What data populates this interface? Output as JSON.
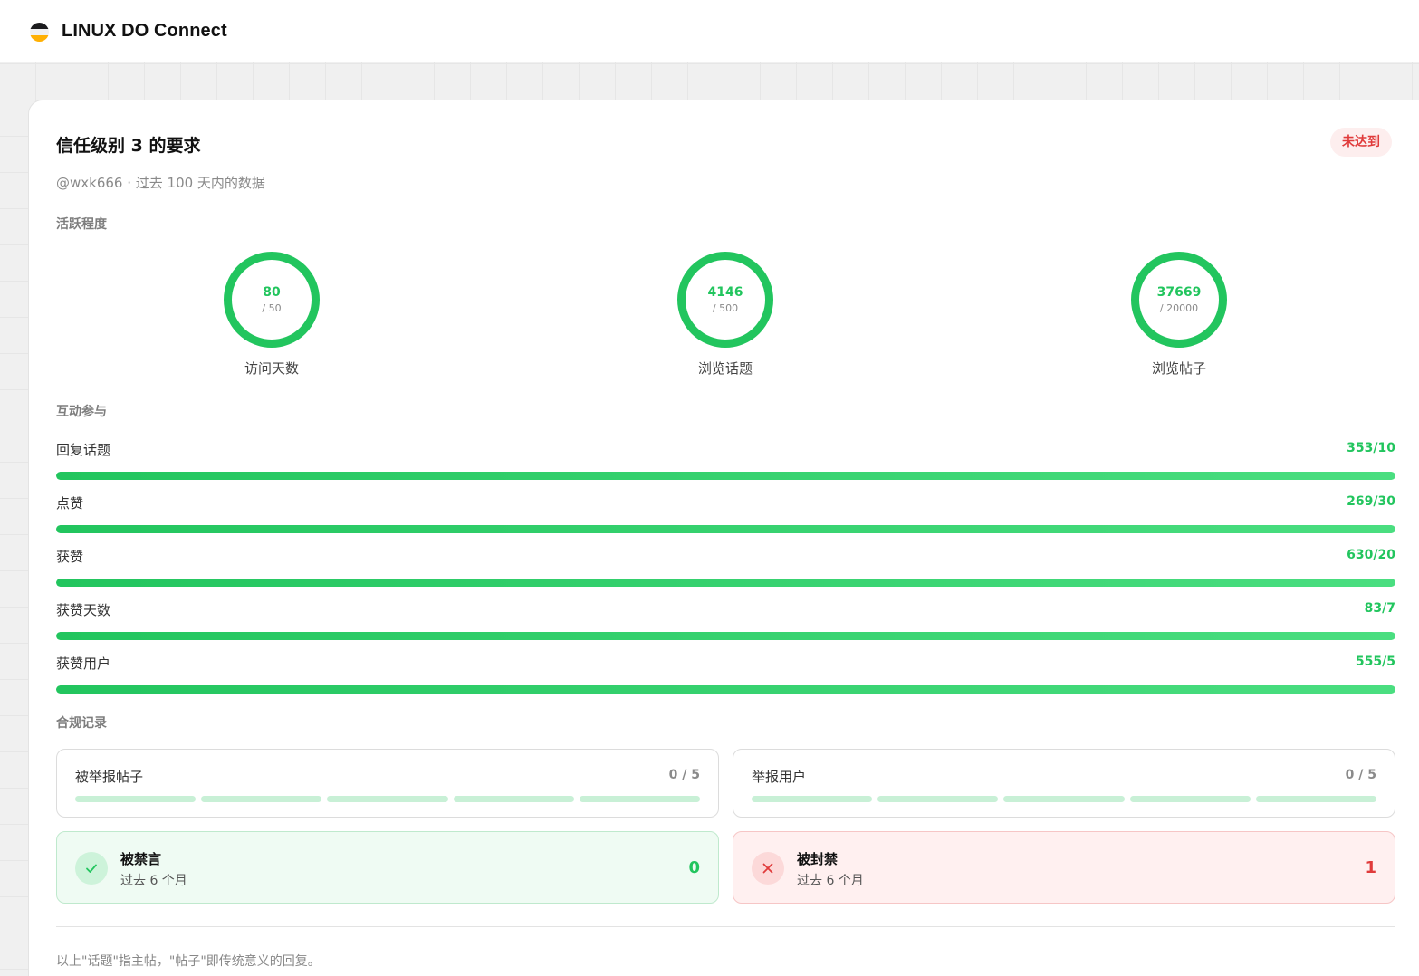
{
  "header": {
    "brand": "LINUX DO Connect"
  },
  "card": {
    "title": "信任级别 3 的要求",
    "status": "未达到",
    "subtitle": "@wxk666 · 过去 100 天内的数据"
  },
  "activity": {
    "section_label": "活跃程度",
    "rings": [
      {
        "label": "访问天数",
        "value": "80",
        "target": "/ 50",
        "progress": 1.0
      },
      {
        "label": "浏览话题",
        "value": "4146",
        "target": "/ 500",
        "progress": 1.0
      },
      {
        "label": "浏览帖子",
        "value": "37669",
        "target": "/ 20000",
        "progress": 1.0
      }
    ]
  },
  "interaction": {
    "section_label": "互动参与",
    "bars": [
      {
        "label": "回复话题",
        "value": "353/10",
        "progress": 1.0
      },
      {
        "label": "点赞",
        "value": "269/30",
        "progress": 1.0
      },
      {
        "label": "获赞",
        "value": "630/20",
        "progress": 1.0
      },
      {
        "label": "获赞天数",
        "value": "83/7",
        "progress": 1.0
      },
      {
        "label": "获赞用户",
        "value": "555/5",
        "progress": 1.0
      }
    ]
  },
  "compliance": {
    "section_label": "合规记录",
    "reported_posts": {
      "label": "被举报帖子",
      "value": "0 / 5"
    },
    "reported_users": {
      "label": "举报用户",
      "value": "0 / 5"
    },
    "silenced": {
      "label": "被禁言",
      "period": "过去 6 个月",
      "count": "0",
      "icon": "check-icon"
    },
    "suspended": {
      "label": "被封禁",
      "period": "过去 6 个月",
      "count": "1",
      "icon": "close-icon"
    }
  },
  "footnote": "以上\"话题\"指主帖，\"帖子\"即传统意义的回复。",
  "colors": {
    "accent_green": "#22c55e",
    "danger_red": "#e03b3b",
    "track_green": "#dcfce7"
  }
}
